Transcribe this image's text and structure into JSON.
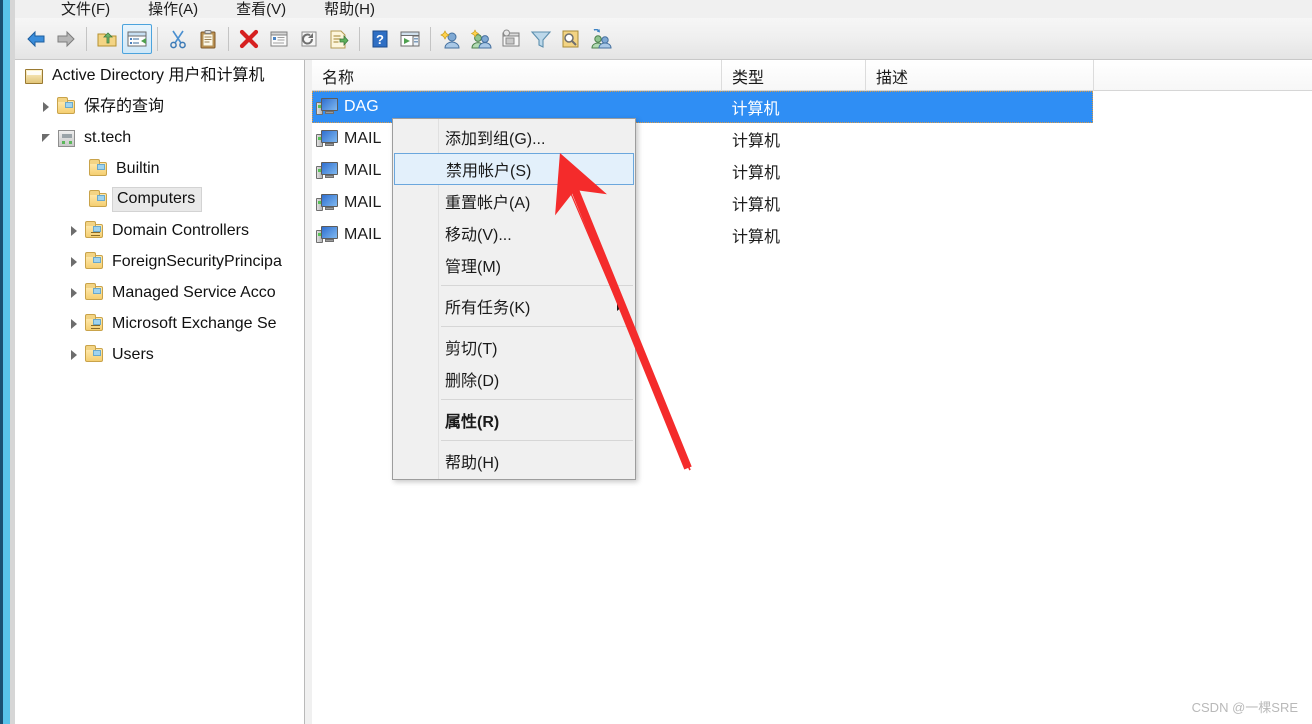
{
  "window": {
    "menubar": [
      {
        "label": "文件(F)",
        "accel": "F"
      },
      {
        "label": "操作(A)",
        "accel": "A"
      },
      {
        "label": "查看(V)",
        "accel": "V"
      },
      {
        "label": "帮助(H)",
        "accel": "H"
      }
    ]
  },
  "toolbar": {
    "buttons": [
      {
        "name": "back-icon"
      },
      {
        "name": "forward-icon"
      },
      {
        "name": "up-one-level-icon"
      },
      {
        "name": "show-hide-console-tree-icon"
      },
      {
        "name": "cut-icon"
      },
      {
        "name": "paste-icon"
      },
      {
        "name": "delete-icon"
      },
      {
        "name": "properties-icon"
      },
      {
        "name": "refresh-icon"
      },
      {
        "name": "export-list-icon"
      },
      {
        "name": "help-icon"
      },
      {
        "name": "show-action-pane-icon"
      },
      {
        "name": "new-user-icon"
      },
      {
        "name": "new-group-icon"
      },
      {
        "name": "new-container-icon"
      },
      {
        "name": "filter-icon"
      },
      {
        "name": "find-icon"
      },
      {
        "name": "add-member-icon"
      }
    ]
  },
  "tree": {
    "items": [
      {
        "label": "Active Directory 用户和计算机",
        "icon": "console-root-icon",
        "indent": 0,
        "expander": "none",
        "selected": false
      },
      {
        "label": "保存的查询",
        "icon": "folder-icon",
        "indent": 1,
        "expander": "closed",
        "selected": false
      },
      {
        "label": "st.tech",
        "icon": "domain-icon",
        "indent": 1,
        "expander": "open",
        "selected": false
      },
      {
        "label": "Builtin",
        "icon": "folder-icon",
        "indent": 2,
        "expander": "none",
        "selected": false
      },
      {
        "label": "Computers",
        "icon": "folder-icon",
        "indent": 2,
        "expander": "none",
        "selected": true
      },
      {
        "label": "Domain Controllers",
        "icon": "ou-folder-icon",
        "indent": 2,
        "expander": "closed",
        "selected": false
      },
      {
        "label": "ForeignSecurityPrincipa",
        "icon": "folder-icon",
        "indent": 2,
        "expander": "closed",
        "selected": false
      },
      {
        "label": "Managed Service Acco",
        "icon": "folder-icon",
        "indent": 2,
        "expander": "closed",
        "selected": false
      },
      {
        "label": "Microsoft Exchange Se",
        "icon": "ou-folder-icon",
        "indent": 2,
        "expander": "closed",
        "selected": false
      },
      {
        "label": "Users",
        "icon": "folder-icon",
        "indent": 2,
        "expander": "closed",
        "selected": false
      }
    ]
  },
  "list": {
    "columns": [
      {
        "label": "名称"
      },
      {
        "label": "类型"
      },
      {
        "label": "描述"
      }
    ],
    "rows": [
      {
        "name": "DAG",
        "type": "计算机",
        "description": "",
        "icon": "computer-icon",
        "selected": true
      },
      {
        "name": "MAIL",
        "type": "计算机",
        "description": "",
        "icon": "computer-icon",
        "selected": false
      },
      {
        "name": "MAIL",
        "type": "计算机",
        "description": "",
        "icon": "computer-icon",
        "selected": false
      },
      {
        "name": "MAIL",
        "type": "计算机",
        "description": "",
        "icon": "computer-icon",
        "selected": false
      },
      {
        "name": "MAIL",
        "type": "计算机",
        "description": "",
        "icon": "computer-icon",
        "selected": false
      }
    ]
  },
  "context_menu": {
    "items": [
      {
        "label": "添加到组(G)...",
        "type": "item",
        "highlighted": false,
        "bold": false,
        "submenu": false
      },
      {
        "label": "禁用帐户(S)",
        "type": "item",
        "highlighted": true,
        "bold": false,
        "submenu": false
      },
      {
        "label": "重置帐户(A)",
        "type": "item",
        "highlighted": false,
        "bold": false,
        "submenu": false
      },
      {
        "label": "移动(V)...",
        "type": "item",
        "highlighted": false,
        "bold": false,
        "submenu": false
      },
      {
        "label": "管理(M)",
        "type": "item",
        "highlighted": false,
        "bold": false,
        "submenu": false
      },
      {
        "type": "separator"
      },
      {
        "label": "所有任务(K)",
        "type": "item",
        "highlighted": false,
        "bold": false,
        "submenu": true
      },
      {
        "type": "separator"
      },
      {
        "label": "剪切(T)",
        "type": "item",
        "highlighted": false,
        "bold": false,
        "submenu": false
      },
      {
        "label": "删除(D)",
        "type": "item",
        "highlighted": false,
        "bold": false,
        "submenu": false
      },
      {
        "type": "separator"
      },
      {
        "label": "属性(R)",
        "type": "item",
        "highlighted": false,
        "bold": true,
        "submenu": false
      },
      {
        "type": "separator"
      },
      {
        "label": "帮助(H)",
        "type": "item",
        "highlighted": false,
        "bold": false,
        "submenu": false
      }
    ]
  },
  "annotation": {
    "arrow_color": "#f42b2b",
    "points_to": "禁用帐户(S)"
  },
  "watermark": {
    "text": "CSDN @一棵SRE"
  },
  "colors": {
    "selection_blue": "#2f8ef4",
    "menu_highlight": "#e3f0fb",
    "window_edge_cyan": "#59c3ea",
    "annotation_red": "#f42b2b"
  }
}
